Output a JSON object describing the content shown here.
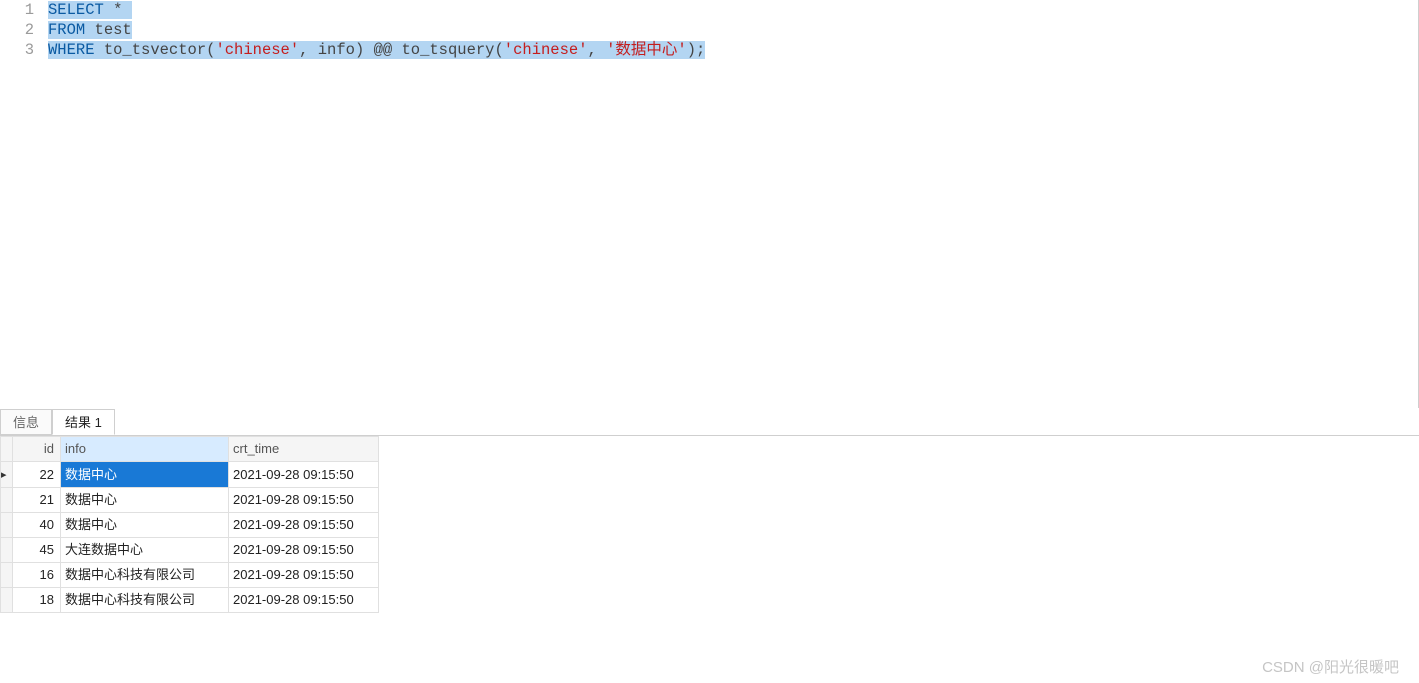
{
  "editor": {
    "lines": [
      {
        "no": "1",
        "segments": [
          {
            "t": "SELECT",
            "cls": "kw",
            "sel": true
          },
          {
            "t": " ",
            "cls": "pl",
            "sel": true
          },
          {
            "t": "*",
            "cls": "pl",
            "sel": true
          },
          {
            "t": " ",
            "cls": "pl",
            "sel": true
          }
        ]
      },
      {
        "no": "2",
        "segments": [
          {
            "t": "FROM",
            "cls": "kw",
            "sel": true
          },
          {
            "t": " test",
            "cls": "pl",
            "sel": true
          }
        ]
      },
      {
        "no": "3",
        "segments": [
          {
            "t": "WHERE",
            "cls": "kw",
            "sel": true
          },
          {
            "t": " to_tsvector(",
            "cls": "pl",
            "sel": true
          },
          {
            "t": "'chinese'",
            "cls": "str",
            "sel": true
          },
          {
            "t": ", info) @@ to_tsquery(",
            "cls": "pl",
            "sel": true
          },
          {
            "t": "'chinese'",
            "cls": "str",
            "sel": true
          },
          {
            "t": ", ",
            "cls": "pl",
            "sel": true
          },
          {
            "t": "'数据中心'",
            "cls": "str",
            "sel": true
          },
          {
            "t": ");",
            "cls": "pl",
            "sel": true
          }
        ]
      }
    ]
  },
  "tabs": [
    {
      "label": "信息",
      "active": false
    },
    {
      "label": "结果 1",
      "active": true
    }
  ],
  "grid": {
    "columns": [
      {
        "key": "id",
        "label": "id",
        "cls": "col-id"
      },
      {
        "key": "info",
        "label": "info",
        "cls": "col-info",
        "selected": true
      },
      {
        "key": "crt_time",
        "label": "crt_time",
        "cls": "col-crt"
      }
    ],
    "rows": [
      {
        "id": "22",
        "info": "数据中心",
        "crt_time": "2021-09-28 09:15:50",
        "sel": true
      },
      {
        "id": "21",
        "info": "数据中心",
        "crt_time": "2021-09-28 09:15:50"
      },
      {
        "id": "40",
        "info": "数据中心",
        "crt_time": "2021-09-28 09:15:50"
      },
      {
        "id": "45",
        "info": "大连数据中心",
        "crt_time": "2021-09-28 09:15:50"
      },
      {
        "id": "16",
        "info": "数据中心科技有限公司",
        "crt_time": "2021-09-28 09:15:50"
      },
      {
        "id": "18",
        "info": "数据中心科技有限公司",
        "crt_time": "2021-09-28 09:15:50"
      }
    ]
  },
  "watermark": "CSDN @阳光很暖吧"
}
